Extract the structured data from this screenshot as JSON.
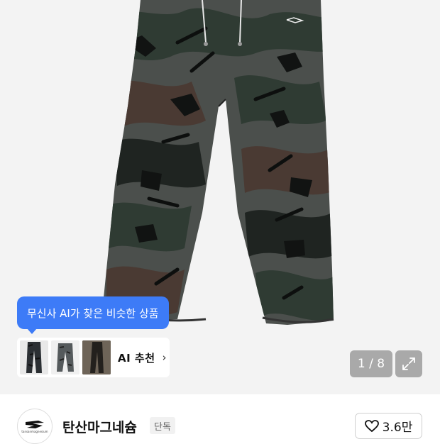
{
  "product_image": {
    "description_icon": "product-photo-camo-pants",
    "page_counter": "1 / 8"
  },
  "ai_recommend": {
    "tooltip": "무신사 AI가 찾은 비슷한 상품",
    "button_label": "AI 추천",
    "chevron": "›",
    "accent_color": "#3d7bf7"
  },
  "brand": {
    "name": "탄산마그네슘",
    "badge": "단독",
    "logo_text": "tansanmagnesium",
    "like_count": "3.6만"
  }
}
